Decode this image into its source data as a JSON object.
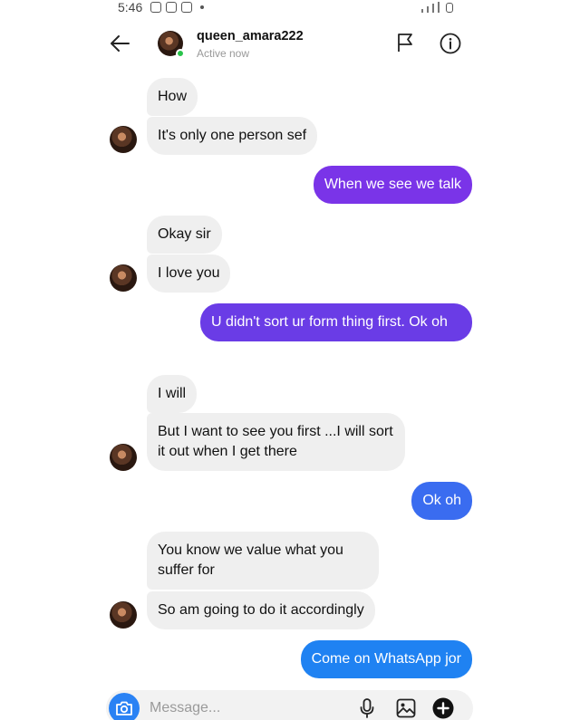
{
  "status_bar": {
    "time": "5:46"
  },
  "header": {
    "username": "queen_amara222",
    "status": "Active now"
  },
  "messages": [
    {
      "from": "them",
      "text": "How"
    },
    {
      "from": "them",
      "text": "It's only one person sef"
    },
    {
      "from": "me",
      "text": "When we see we talk"
    },
    {
      "from": "them",
      "text": "Okay sir"
    },
    {
      "from": "them",
      "text": "I love you"
    },
    {
      "from": "me",
      "text": "U didn't sort ur form thing first. Ok oh"
    },
    {
      "from": "them",
      "text": "I will"
    },
    {
      "from": "them",
      "text": "But I want to see you first ...I will sort it out when I get there"
    },
    {
      "from": "me",
      "text": "Ok oh"
    },
    {
      "from": "them",
      "text": "You know we value what you suffer for"
    },
    {
      "from": "them",
      "text": "So am going to do it accordingly"
    },
    {
      "from": "me",
      "text": "Come on WhatsApp jor"
    }
  ],
  "composer": {
    "placeholder": "Message..."
  },
  "colors": {
    "accent_purple": "#7c33e6",
    "accent_blue": "#2a82f4",
    "online": "#29c34a"
  },
  "icons": [
    "back-arrow-icon",
    "flag-icon",
    "info-icon",
    "camera-icon",
    "mic-icon",
    "gallery-icon",
    "plus-icon"
  ]
}
